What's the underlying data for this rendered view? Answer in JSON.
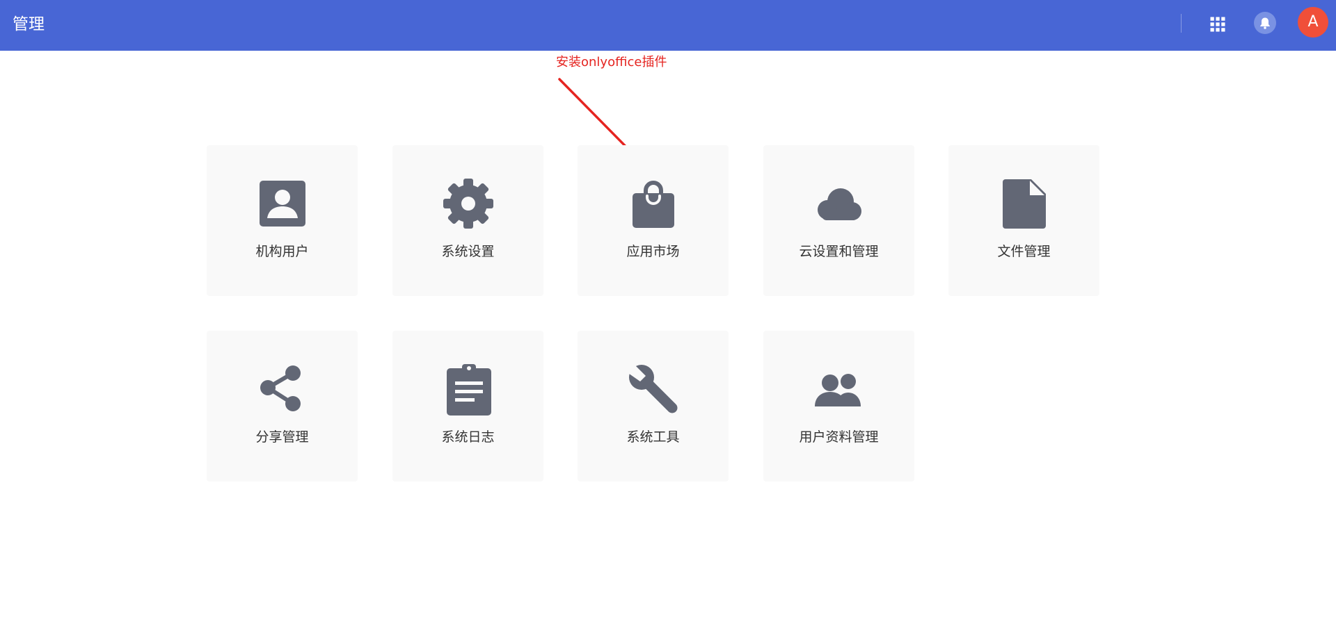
{
  "header": {
    "title": "管理",
    "avatar_initial": "A",
    "apps_icon": "apps-grid-icon",
    "bell_icon": "bell-icon"
  },
  "annotation": {
    "text": "安装onlyoffice插件",
    "color": "#e52420"
  },
  "tiles": [
    {
      "label": "机构用户",
      "icon": "account-box-icon"
    },
    {
      "label": "系统设置",
      "icon": "gear-icon"
    },
    {
      "label": "应用市场",
      "icon": "shopping-bag-icon"
    },
    {
      "label": "云设置和管理",
      "icon": "cloud-icon"
    },
    {
      "label": "文件管理",
      "icon": "file-icon"
    },
    {
      "label": "分享管理",
      "icon": "share-icon"
    },
    {
      "label": "系统日志",
      "icon": "clipboard-icon"
    },
    {
      "label": "系统工具",
      "icon": "wrench-icon"
    },
    {
      "label": "用户资料管理",
      "icon": "people-icon"
    }
  ],
  "colors": {
    "header_bg": "#4866d5",
    "icon": "#626775",
    "tile_bg": "#f9f9f9",
    "avatar_bg": "#f04f39"
  }
}
